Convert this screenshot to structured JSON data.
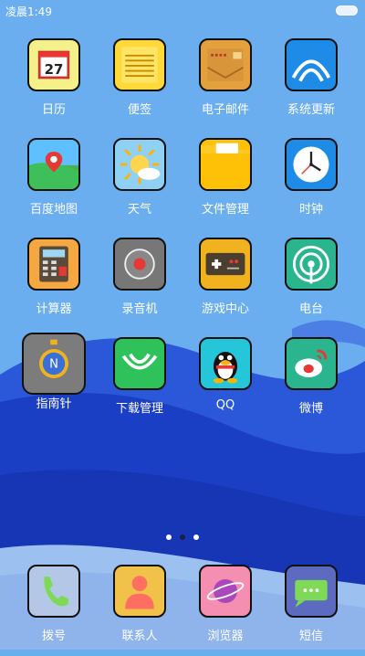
{
  "status_bar": {
    "time": "凌晨1:49"
  },
  "apps": [
    {
      "label": "日历",
      "icon": "calendar-icon",
      "date": "27"
    },
    {
      "label": "便签",
      "icon": "notes-icon"
    },
    {
      "label": "电子邮件",
      "icon": "email-icon"
    },
    {
      "label": "系统更新",
      "icon": "system-update-icon"
    },
    {
      "label": "百度地图",
      "icon": "map-icon"
    },
    {
      "label": "天气",
      "icon": "weather-icon"
    },
    {
      "label": "文件管理",
      "icon": "folder-icon"
    },
    {
      "label": "时钟",
      "icon": "clock-icon"
    },
    {
      "label": "计算器",
      "icon": "calculator-icon"
    },
    {
      "label": "录音机",
      "icon": "recorder-icon"
    },
    {
      "label": "游戏中心",
      "icon": "gamepad-icon"
    },
    {
      "label": "电台",
      "icon": "radio-icon"
    },
    {
      "label": "指南针",
      "icon": "compass-icon"
    },
    {
      "label": "下载管理",
      "icon": "download-icon"
    },
    {
      "label": "QQ",
      "icon": "qq-penguin-icon"
    },
    {
      "label": "微博",
      "icon": "weibo-icon"
    }
  ],
  "page_indicator": {
    "count": 3,
    "active": 2
  },
  "dock": [
    {
      "label": "拨号",
      "icon": "phone-icon"
    },
    {
      "label": "联系人",
      "icon": "contacts-icon"
    },
    {
      "label": "浏览器",
      "icon": "browser-icon"
    },
    {
      "label": "短信",
      "icon": "message-icon"
    }
  ]
}
